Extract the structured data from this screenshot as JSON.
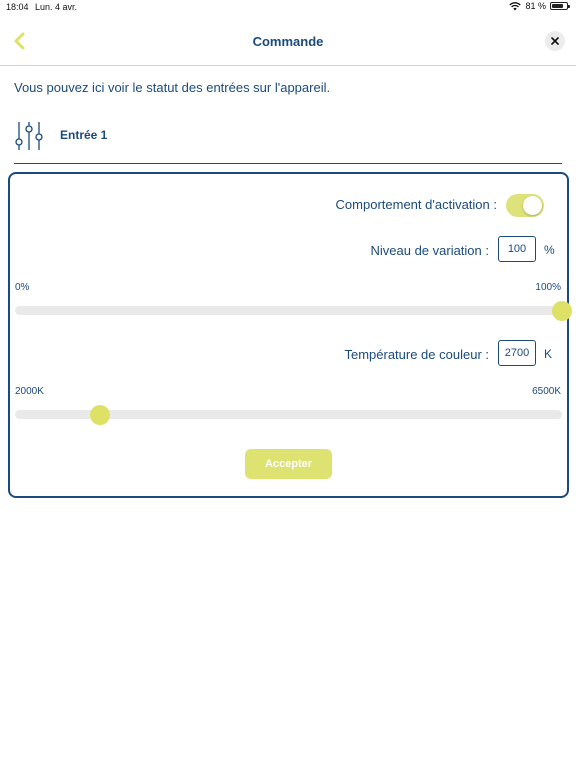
{
  "status_bar": {
    "time": "18:04",
    "date": "Lun. 4 avr.",
    "battery": "81 %",
    "battery_level": 0.81
  },
  "nav": {
    "title": "Commande"
  },
  "intro_text": "Vous pouvez ici voir le statut des entrées sur l'appareil.",
  "input": {
    "title": "Entrée 1"
  },
  "controls": {
    "activation_label": "Comportement d'activation :",
    "activation_on": true,
    "variation_label": "Niveau de variation :",
    "variation_value": "100",
    "variation_unit": "%",
    "variation_min_label": "0%",
    "variation_max_label": "100%",
    "variation_level": 100,
    "temperature_label": "Température de couleur :",
    "temperature_value": "2700",
    "temperature_unit": "K",
    "temperature_min_label": "2000K",
    "temperature_max_label": "6500K",
    "temperature_min": 2000,
    "temperature_max": 6500,
    "temperature_level": 2700
  },
  "accept_label": "Accepter",
  "colors": {
    "primary": "#1b4a7c",
    "accent": "#dde266"
  }
}
